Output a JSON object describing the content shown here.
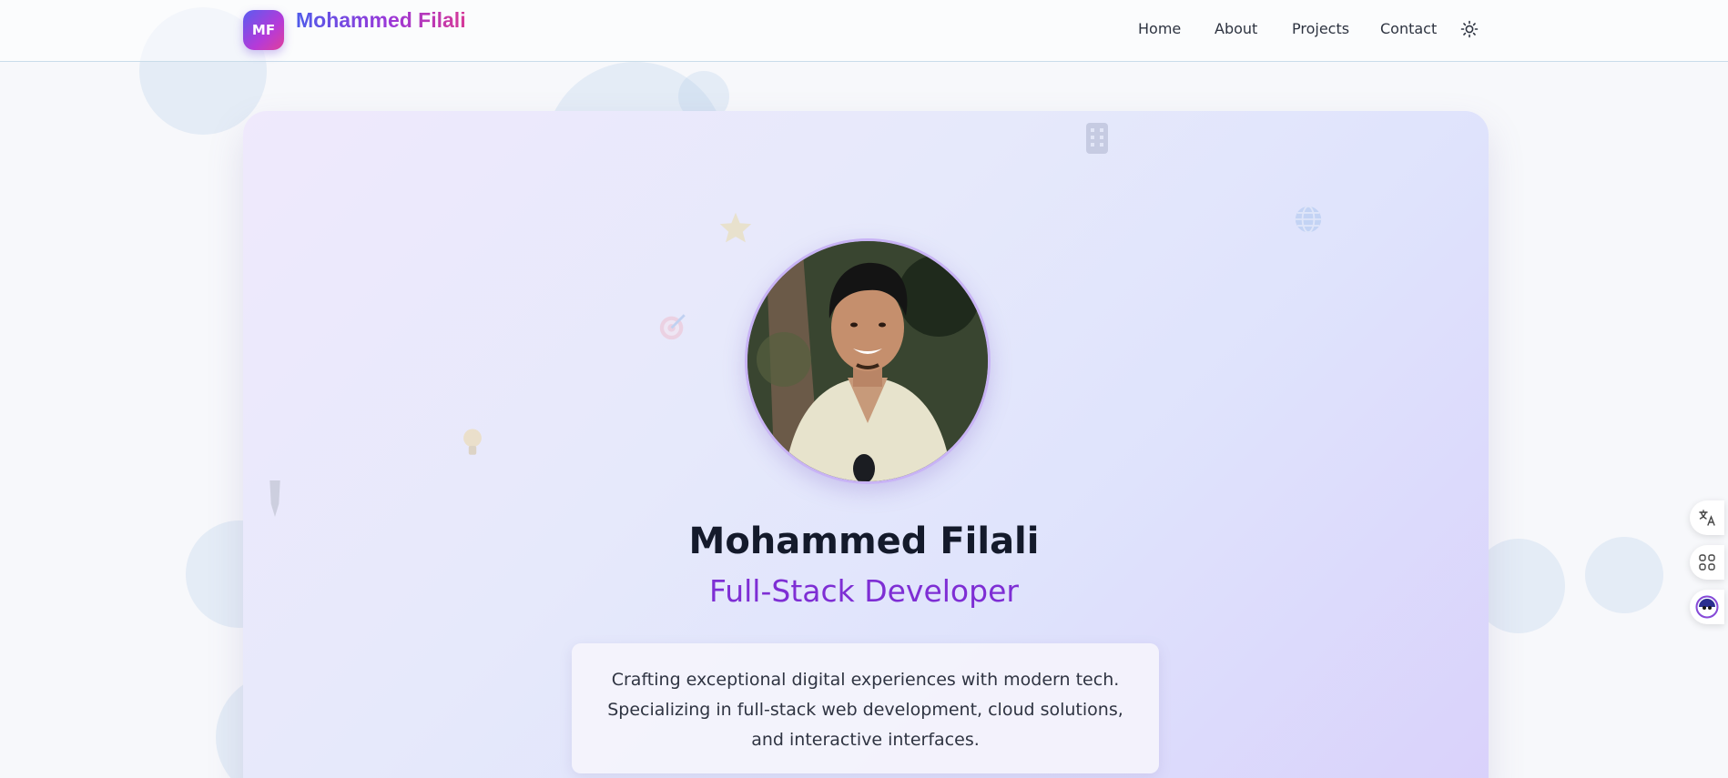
{
  "header": {
    "logo_initials": "MF",
    "brand_name": "Mohammed Filali",
    "nav": [
      "Home",
      "About",
      "Projects",
      "Contact"
    ],
    "theme_toggle_icon": "sun-icon"
  },
  "hero": {
    "name": "Mohammed Filali",
    "role": "Full-Stack Developer",
    "tagline": "Crafting exceptional digital experiences with modern tech. Specializing in full-stack web development, cloud solutions, and interactive interfaces."
  },
  "side_widgets": [
    "translate-icon",
    "apps-icon",
    "assistant-icon"
  ],
  "colors": {
    "brand_gradient_start": "#4f5bea",
    "brand_gradient_end": "#d63a98",
    "role_purple": "#7e2ed4",
    "name_dark": "#141a2b"
  }
}
